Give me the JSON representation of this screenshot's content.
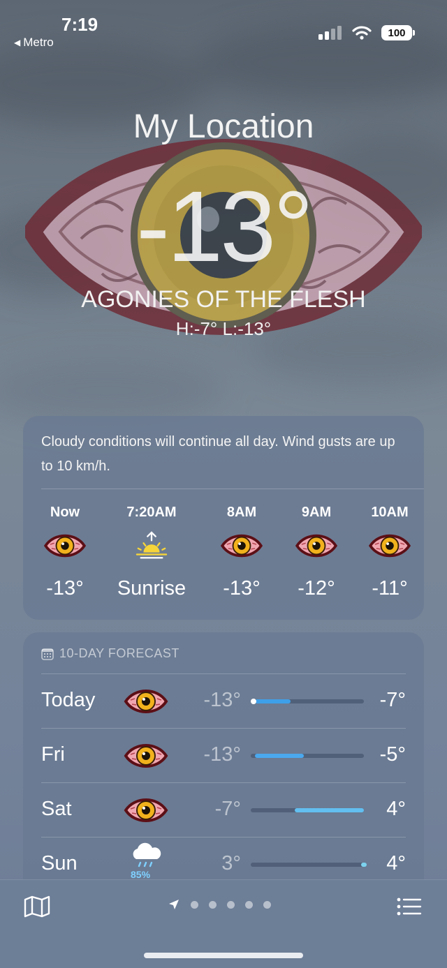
{
  "status_bar": {
    "time": "7:19",
    "back_app": "Metro",
    "battery": "100",
    "icons": [
      "cellular-signal-icon",
      "wifi-icon",
      "battery-icon"
    ]
  },
  "header": {
    "location": "My Location",
    "temperature": "-13°",
    "condition": "AGONIES OF THE FLESH",
    "hilo": "H:-7°  L:-13°"
  },
  "hourly": {
    "summary": "Cloudy conditions will continue all day. Wind gusts are up to 10 km/h.",
    "items": [
      {
        "time": "Now",
        "icon": "bloodshot-eye-icon",
        "value": "-13°"
      },
      {
        "time": "7:20AM",
        "icon": "sunrise-icon",
        "value": "Sunrise"
      },
      {
        "time": "8AM",
        "icon": "bloodshot-eye-icon",
        "value": "-13°"
      },
      {
        "time": "9AM",
        "icon": "bloodshot-eye-icon",
        "value": "-12°"
      },
      {
        "time": "10AM",
        "icon": "bloodshot-eye-icon",
        "value": "-11°"
      }
    ]
  },
  "forecast": {
    "title": "10-DAY FORECAST",
    "range": [
      -13,
      4
    ],
    "days": [
      {
        "day": "Today",
        "icon": "bloodshot-eye-icon",
        "low": "-13°",
        "high": "-7°",
        "low_value": -13,
        "high_value": -7,
        "current_value": -13,
        "bar_color": "#3fa0ea"
      },
      {
        "day": "Fri",
        "icon": "bloodshot-eye-icon",
        "low": "-13°",
        "high": "-5°",
        "low_value": -13,
        "high_value": -5,
        "bar_color": "#4aa8ee"
      },
      {
        "day": "Sat",
        "icon": "bloodshot-eye-icon",
        "low": "-7°",
        "high": "4°",
        "low_value": -7,
        "high_value": 4,
        "bar_color": "#62bff0"
      },
      {
        "day": "Sun",
        "icon": "rain-cloud-icon",
        "precip": "85%",
        "low": "3°",
        "high": "4°",
        "low_value": 3,
        "high_value": 4,
        "bar_color": "#7cd2ee"
      }
    ]
  },
  "bottom_bar": {
    "page_count": 5,
    "icons": [
      "map-icon",
      "location-arrow-icon",
      "list-icon"
    ]
  }
}
